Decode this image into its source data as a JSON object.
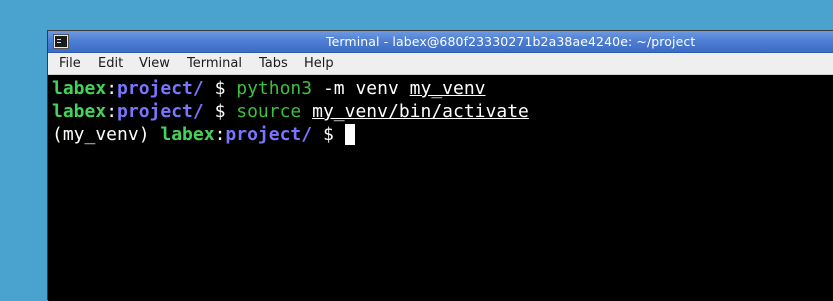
{
  "window": {
    "title": "Terminal - labex@680f23330271b2a38ae4240e: ~/project"
  },
  "menubar": {
    "items": [
      "File",
      "Edit",
      "View",
      "Terminal",
      "Tabs",
      "Help"
    ]
  },
  "terminal": {
    "lines": [
      {
        "venv": "",
        "user": "labex",
        "sep": ":",
        "path": "project/",
        "prompt": " $ ",
        "cmd": "python3",
        "args": " -m venv ",
        "underlined_arg": "my_venv"
      },
      {
        "venv": "",
        "user": "labex",
        "sep": ":",
        "path": "project/",
        "prompt": " $ ",
        "cmd": "source",
        "args": " ",
        "underlined_arg": "my_venv/bin/activate"
      },
      {
        "venv": "(my_venv) ",
        "user": "labex",
        "sep": ":",
        "path": "project/",
        "prompt": " $ "
      }
    ]
  },
  "colors": {
    "desktop": "#4aa3cf",
    "titlebar": "#4e7fd4",
    "user": "#44d35a",
    "path": "#7b74ff",
    "command": "#3fbf3f",
    "terminal_bg": "#000000"
  }
}
